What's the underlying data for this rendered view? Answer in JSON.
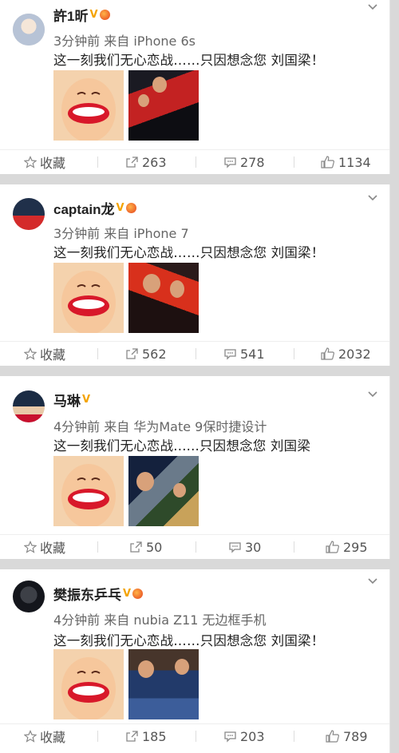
{
  "posts": [
    {
      "user": "許1昕",
      "meta": "3分钟前 来自 iPhone 6s",
      "text": "这一刻我们无心恋战……只因想念您 刘国梁！",
      "actions": {
        "fav": "收藏",
        "repost": "263",
        "comment": "278",
        "like": "1134"
      }
    },
    {
      "user": "captain龙",
      "meta": "3分钟前 来自 iPhone 7",
      "text": "这一刻我们无心恋战……只因想念您 刘国梁！",
      "actions": {
        "fav": "收藏",
        "repost": "562",
        "comment": "541",
        "like": "2032"
      }
    },
    {
      "user": "马琳",
      "meta": "4分钟前 来自 华为Mate 9保时捷设计",
      "text": "这一刻我们无心恋战......只因想念您 刘国梁",
      "actions": {
        "fav": "收藏",
        "repost": "50",
        "comment": "30",
        "like": "295"
      }
    },
    {
      "user": "樊振东乒乓",
      "meta": "4分钟前 来自 nubia Z11 无边框手机",
      "text": "这一刻我们无心恋战……只因想念您 刘国梁！",
      "actions": {
        "fav": "收藏",
        "repost": "185",
        "comment": "203",
        "like": "789"
      }
    }
  ],
  "colors": {
    "vip": "#f4a300",
    "icon": "#888888",
    "background": "#d9d9d9"
  }
}
